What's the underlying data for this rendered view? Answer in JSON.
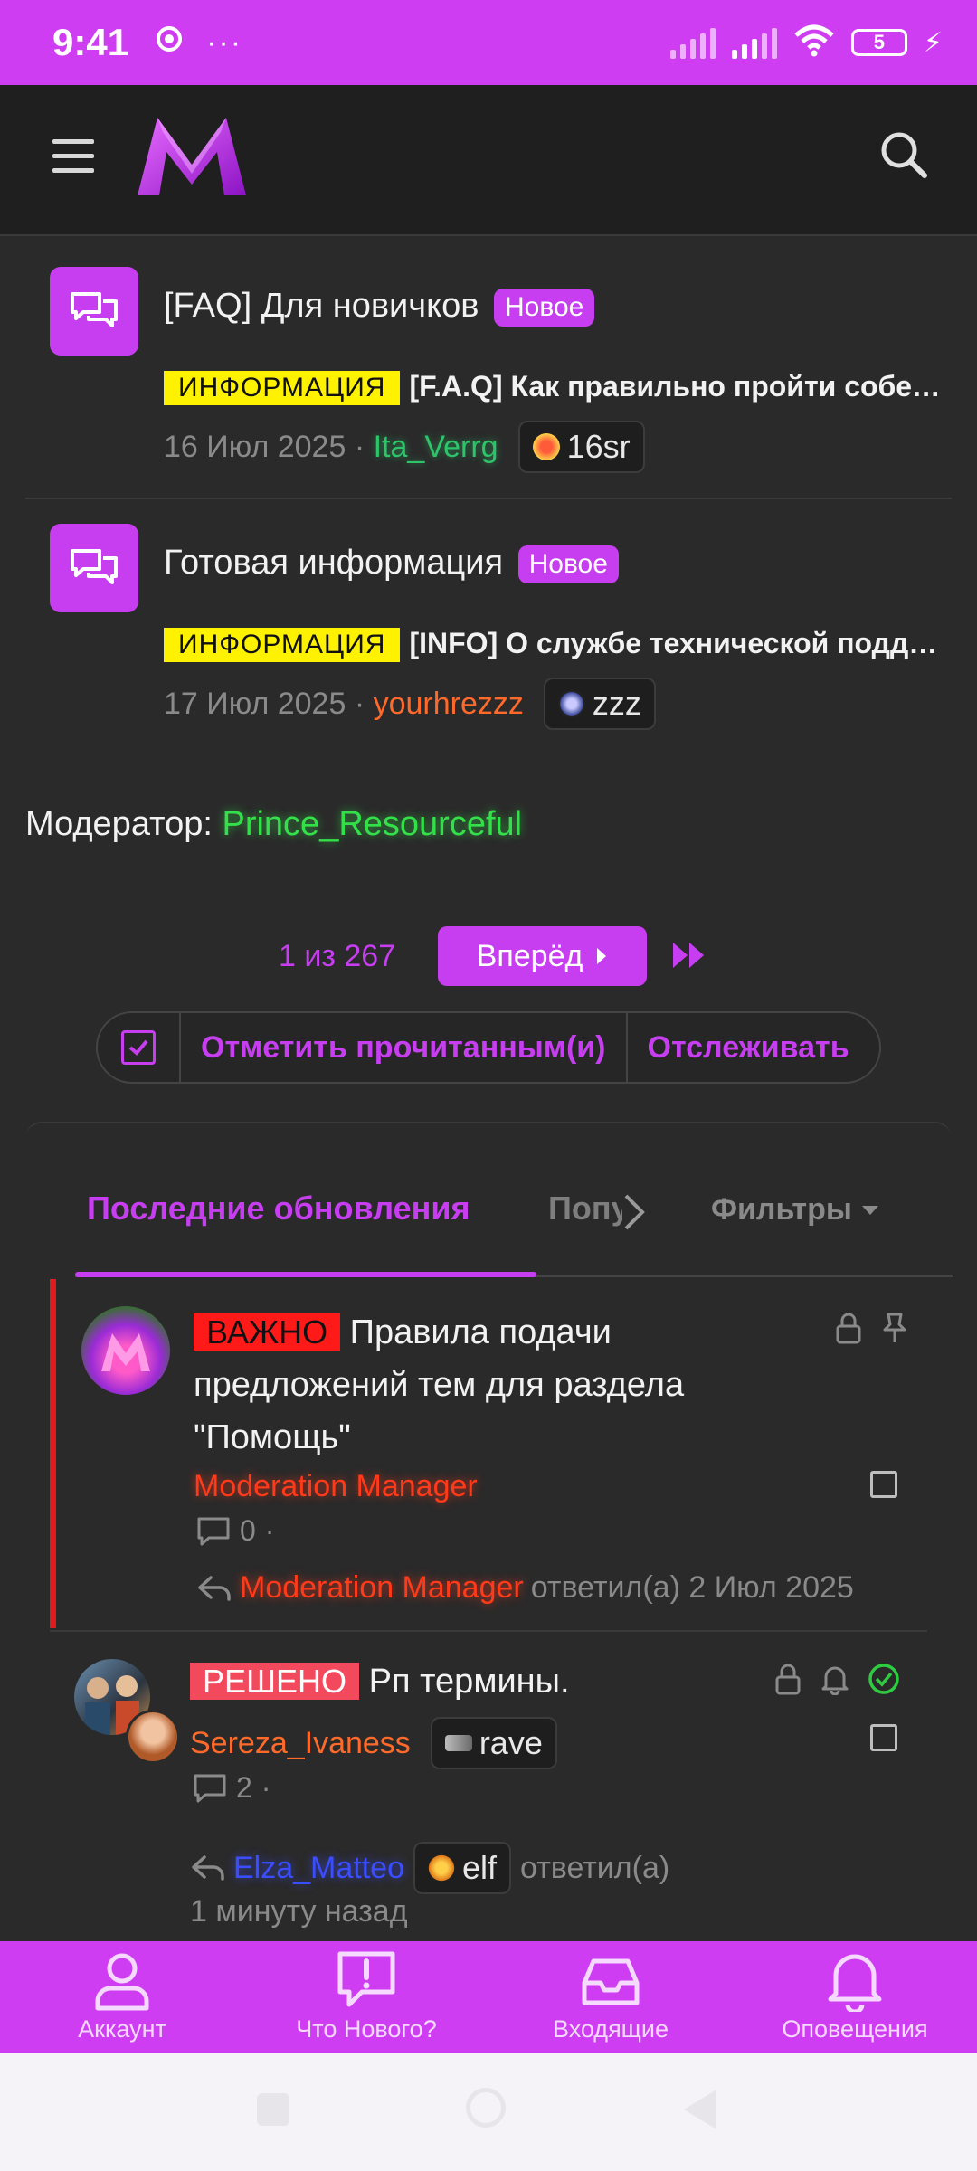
{
  "status_bar": {
    "time": "9:41",
    "dots": "···",
    "battery": "5"
  },
  "nodes": [
    {
      "title": "[FAQ] Для новичков",
      "badge": "Новое",
      "prefix": "ИНФОРМАЦИЯ",
      "last_thread": "[F.A.Q] Как правильно пройти собеседование",
      "date": "16 Июл 2025",
      "user": "Ita_Verrg",
      "user_color": "#2ec46a",
      "chip": "16sr"
    },
    {
      "title": "Готовая информация",
      "badge": "Новое",
      "prefix": "ИНФОРМАЦИЯ",
      "last_thread": "[INFO] О службе технической поддержки",
      "date": "17 Июл 2025",
      "user": "yourhrezzz",
      "user_color": "#ff6a2a",
      "chip": "zzz"
    }
  ],
  "moderator": {
    "label": "Модератор:",
    "name": "Prince_Resourceful"
  },
  "pager": {
    "text": "1 из 267",
    "next": "Вперёд"
  },
  "actions": {
    "mark_read": "Отметить прочитанным(и)",
    "watch": "Отслеживать"
  },
  "tabs": {
    "active": "Последние обновления",
    "popular": "Популярные",
    "filters": "Фильтры"
  },
  "threads": [
    {
      "prefix": "ВАЖНО",
      "title": "Правила подачи предложений тем для раздела \"Помощь\"",
      "author": "Moderation Manager",
      "replies": "0",
      "last_user": "Moderation Manager",
      "last_text": "ответил(а) 2 Июл 2025"
    },
    {
      "prefix": "РЕШЕНО",
      "title": "Рп термины.",
      "author": "Sereza_Ivaness",
      "author_chip": "rave",
      "replies": "2",
      "last_user": "Elza_Matteo",
      "last_chip": "elf",
      "last_text": "ответил(а)",
      "last_time": "1 минуту назад"
    }
  ],
  "bottom_nav": [
    "Аккаунт",
    "Что Нового?",
    "Входящие",
    "Оповещения"
  ],
  "colors": {
    "accent": "#c63ef0",
    "status_bar": "#cf3df2",
    "background": "#2a2a2a"
  }
}
